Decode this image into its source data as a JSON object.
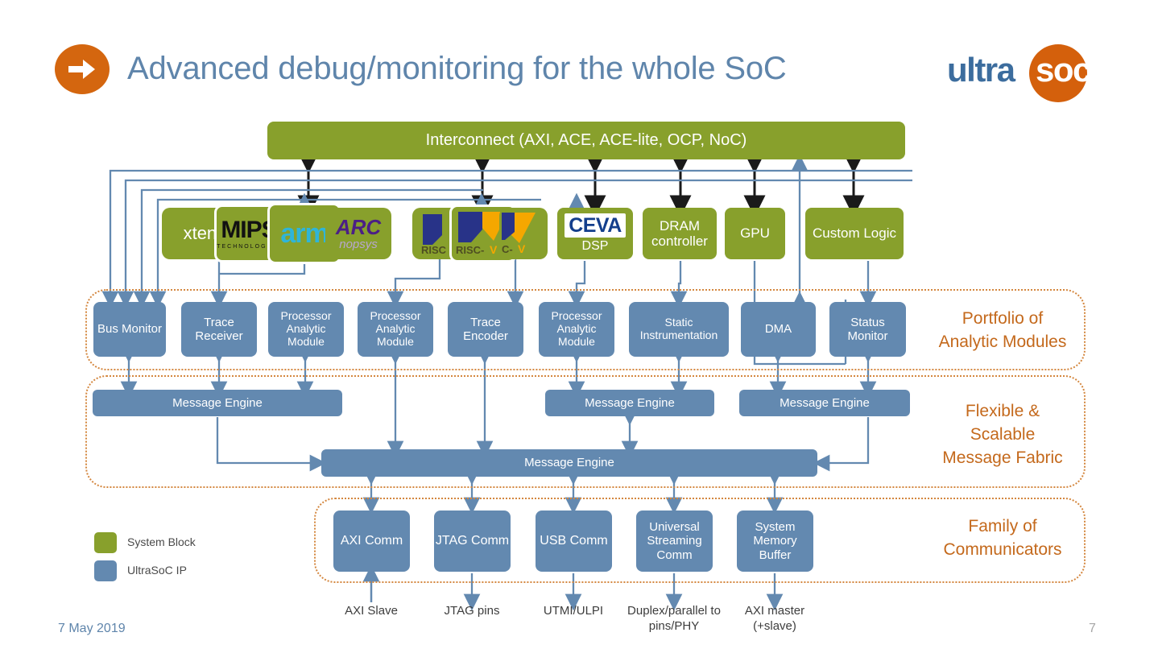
{
  "slide": {
    "title": "Advanced debug/monitoring for the whole SoC",
    "footer_date": "7 May 2019",
    "page_number": "7",
    "logo_word": "ultra",
    "logo_soc": "soc"
  },
  "colors": {
    "system_block_green": "#88a02c",
    "ultrasoc_ip_blue": "#6389b0",
    "accent_orange": "#d4600c",
    "group_outline_orange": "#d4873f",
    "group_label_orange": "#c4691c",
    "title_blue": "#5f85ab"
  },
  "interconnect": {
    "label": "Interconnect (AXI, ACE, ACE-lite, OCP, NoC)"
  },
  "ip_blocks": [
    {
      "name": "xtensa-logo-tile",
      "label": "xtensa",
      "kind": "logo"
    },
    {
      "name": "mips-logo-tile",
      "label": "MIPS TECHNOLOGIES",
      "kind": "logo"
    },
    {
      "name": "arm-logo-tile",
      "label": "arm",
      "kind": "logo"
    },
    {
      "name": "arc-synopsys-logo-tile",
      "label": "ARC synopsys",
      "kind": "logo"
    },
    {
      "name": "riscv-logo-tile-1",
      "label": "RISC-V",
      "kind": "logo"
    },
    {
      "name": "riscv-logo-tile-2",
      "label": "RISC-V",
      "kind": "logo"
    },
    {
      "name": "riscv-logo-tile-3",
      "label": "RISC-V",
      "kind": "logo"
    },
    {
      "name": "ceva-dsp-block",
      "label": "CEVA",
      "sublabel": "DSP",
      "kind": "logo"
    },
    {
      "name": "dram-controller-block",
      "label": "DRAM controller",
      "kind": "text"
    },
    {
      "name": "gpu-block",
      "label": "GPU",
      "kind": "text"
    },
    {
      "name": "custom-logic-block",
      "label": "Custom Logic",
      "kind": "text"
    }
  ],
  "analytic_modules": {
    "group_label": "Portfolio of\nAnalytic Modules",
    "group_label_line1": "Portfolio of",
    "group_label_line2": "Analytic Modules",
    "blocks": [
      {
        "label": "Bus Monitor"
      },
      {
        "label": "Trace Receiver"
      },
      {
        "label": "Processor Analytic Module"
      },
      {
        "label": "Processor Analytic Module"
      },
      {
        "label": "Trace Encoder"
      },
      {
        "label": "Processor Analytic Module"
      },
      {
        "label": "Static Instrumentation"
      },
      {
        "label": "DMA"
      },
      {
        "label": "Status Monitor"
      }
    ]
  },
  "message_fabric": {
    "group_label_line1": "Flexible &",
    "group_label_line2": "Scalable",
    "group_label_line3": "Message Fabric",
    "engines": [
      {
        "label": "Message Engine"
      },
      {
        "label": "Message Engine"
      },
      {
        "label": "Message Engine"
      },
      {
        "label": "Message Engine"
      }
    ]
  },
  "communicators": {
    "group_label_line1": "Family of",
    "group_label_line2": "Communicators",
    "blocks": [
      {
        "label": "AXI Comm",
        "io": "AXI Slave"
      },
      {
        "label": "JTAG Comm",
        "io": "JTAG pins"
      },
      {
        "label": "USB Comm",
        "io": "UTMI/ULPI"
      },
      {
        "label": "Universal Streaming Comm",
        "io": "Duplex/parallel to pins/PHY"
      },
      {
        "label": "System Memory Buffer",
        "io": "AXI master (+slave)"
      }
    ]
  },
  "legend": [
    {
      "label": "System Block",
      "color": "#88a02c"
    },
    {
      "label": "UltraSoC IP",
      "color": "#6389b0"
    }
  ]
}
